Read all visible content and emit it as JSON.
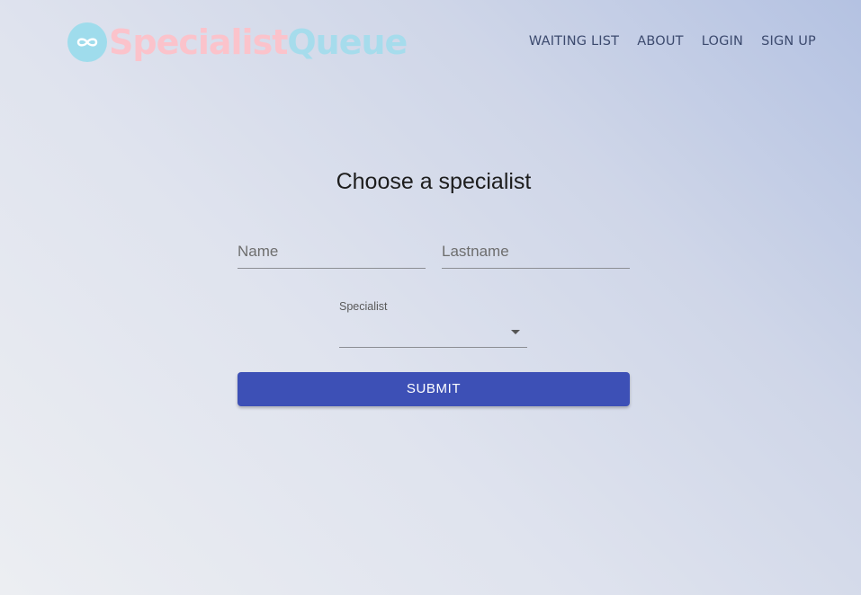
{
  "header": {
    "logo": {
      "icon": "infinity-icon",
      "text_part1": "Specialist",
      "text_part2": "Queue",
      "colors": {
        "circle": "#9fdcec",
        "part1": "#fbc3cb",
        "part2": "#a6dcec"
      }
    },
    "nav": [
      "WAITING LIST",
      "ABOUT",
      "LOGIN",
      "SIGN UP"
    ]
  },
  "form": {
    "title": "Choose a specialist",
    "name_placeholder": "Name",
    "lastname_placeholder": "Lastname",
    "specialist_label": "Specialist",
    "specialist_value": "",
    "submit_label": "SUBMIT",
    "submit_color": "#3d50b6"
  }
}
